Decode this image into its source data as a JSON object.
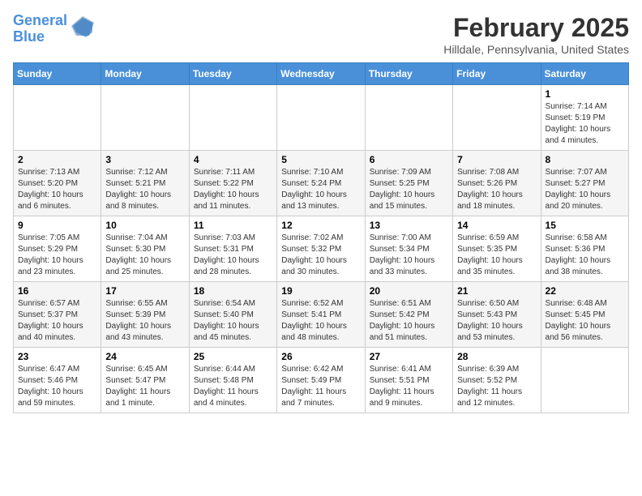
{
  "logo": {
    "line1": "General",
    "line2": "Blue"
  },
  "title": "February 2025",
  "location": "Hilldale, Pennsylvania, United States",
  "days_of_week": [
    "Sunday",
    "Monday",
    "Tuesday",
    "Wednesday",
    "Thursday",
    "Friday",
    "Saturday"
  ],
  "weeks": [
    [
      {
        "day": "",
        "info": ""
      },
      {
        "day": "",
        "info": ""
      },
      {
        "day": "",
        "info": ""
      },
      {
        "day": "",
        "info": ""
      },
      {
        "day": "",
        "info": ""
      },
      {
        "day": "",
        "info": ""
      },
      {
        "day": "1",
        "info": "Sunrise: 7:14 AM\nSunset: 5:19 PM\nDaylight: 10 hours and 4 minutes."
      }
    ],
    [
      {
        "day": "2",
        "info": "Sunrise: 7:13 AM\nSunset: 5:20 PM\nDaylight: 10 hours and 6 minutes."
      },
      {
        "day": "3",
        "info": "Sunrise: 7:12 AM\nSunset: 5:21 PM\nDaylight: 10 hours and 8 minutes."
      },
      {
        "day": "4",
        "info": "Sunrise: 7:11 AM\nSunset: 5:22 PM\nDaylight: 10 hours and 11 minutes."
      },
      {
        "day": "5",
        "info": "Sunrise: 7:10 AM\nSunset: 5:24 PM\nDaylight: 10 hours and 13 minutes."
      },
      {
        "day": "6",
        "info": "Sunrise: 7:09 AM\nSunset: 5:25 PM\nDaylight: 10 hours and 15 minutes."
      },
      {
        "day": "7",
        "info": "Sunrise: 7:08 AM\nSunset: 5:26 PM\nDaylight: 10 hours and 18 minutes."
      },
      {
        "day": "8",
        "info": "Sunrise: 7:07 AM\nSunset: 5:27 PM\nDaylight: 10 hours and 20 minutes."
      }
    ],
    [
      {
        "day": "9",
        "info": "Sunrise: 7:05 AM\nSunset: 5:29 PM\nDaylight: 10 hours and 23 minutes."
      },
      {
        "day": "10",
        "info": "Sunrise: 7:04 AM\nSunset: 5:30 PM\nDaylight: 10 hours and 25 minutes."
      },
      {
        "day": "11",
        "info": "Sunrise: 7:03 AM\nSunset: 5:31 PM\nDaylight: 10 hours and 28 minutes."
      },
      {
        "day": "12",
        "info": "Sunrise: 7:02 AM\nSunset: 5:32 PM\nDaylight: 10 hours and 30 minutes."
      },
      {
        "day": "13",
        "info": "Sunrise: 7:00 AM\nSunset: 5:34 PM\nDaylight: 10 hours and 33 minutes."
      },
      {
        "day": "14",
        "info": "Sunrise: 6:59 AM\nSunset: 5:35 PM\nDaylight: 10 hours and 35 minutes."
      },
      {
        "day": "15",
        "info": "Sunrise: 6:58 AM\nSunset: 5:36 PM\nDaylight: 10 hours and 38 minutes."
      }
    ],
    [
      {
        "day": "16",
        "info": "Sunrise: 6:57 AM\nSunset: 5:37 PM\nDaylight: 10 hours and 40 minutes."
      },
      {
        "day": "17",
        "info": "Sunrise: 6:55 AM\nSunset: 5:39 PM\nDaylight: 10 hours and 43 minutes."
      },
      {
        "day": "18",
        "info": "Sunrise: 6:54 AM\nSunset: 5:40 PM\nDaylight: 10 hours and 45 minutes."
      },
      {
        "day": "19",
        "info": "Sunrise: 6:52 AM\nSunset: 5:41 PM\nDaylight: 10 hours and 48 minutes."
      },
      {
        "day": "20",
        "info": "Sunrise: 6:51 AM\nSunset: 5:42 PM\nDaylight: 10 hours and 51 minutes."
      },
      {
        "day": "21",
        "info": "Sunrise: 6:50 AM\nSunset: 5:43 PM\nDaylight: 10 hours and 53 minutes."
      },
      {
        "day": "22",
        "info": "Sunrise: 6:48 AM\nSunset: 5:45 PM\nDaylight: 10 hours and 56 minutes."
      }
    ],
    [
      {
        "day": "23",
        "info": "Sunrise: 6:47 AM\nSunset: 5:46 PM\nDaylight: 10 hours and 59 minutes."
      },
      {
        "day": "24",
        "info": "Sunrise: 6:45 AM\nSunset: 5:47 PM\nDaylight: 11 hours and 1 minute."
      },
      {
        "day": "25",
        "info": "Sunrise: 6:44 AM\nSunset: 5:48 PM\nDaylight: 11 hours and 4 minutes."
      },
      {
        "day": "26",
        "info": "Sunrise: 6:42 AM\nSunset: 5:49 PM\nDaylight: 11 hours and 7 minutes."
      },
      {
        "day": "27",
        "info": "Sunrise: 6:41 AM\nSunset: 5:51 PM\nDaylight: 11 hours and 9 minutes."
      },
      {
        "day": "28",
        "info": "Sunrise: 6:39 AM\nSunset: 5:52 PM\nDaylight: 11 hours and 12 minutes."
      },
      {
        "day": "",
        "info": ""
      }
    ]
  ]
}
